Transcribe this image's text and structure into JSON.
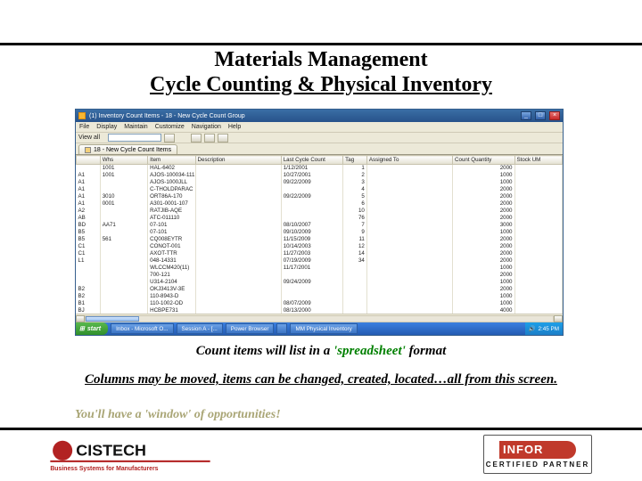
{
  "slide": {
    "title_line1": "Materials Management",
    "title_line2": "Cycle Counting & Physical Inventory",
    "caption1_prefix": "Count items will list in a ",
    "caption1_green": "'spreadsheet'",
    "caption1_suffix": " format",
    "caption2": "Columns may be moved, items can be changed, created, located…all from this screen.",
    "caption3": "You'll have a 'window' of opportunities!"
  },
  "logos": {
    "cistech_name": "CISTECH",
    "cistech_tag": "Business Systems for Manufacturers",
    "infor_name": "INFOR",
    "infor_tag": "CERTIFIED PARTNER"
  },
  "app": {
    "titlebar": "(1) Inventory Count Items - 18 - New Cycle Count Group",
    "menus": [
      "File",
      "Display",
      "Maintain",
      "Customize",
      "Navigation",
      "Help"
    ],
    "toolbar_label": "View all",
    "subtab": "18 - New Cycle Count Items",
    "columns": [
      "",
      "Whs",
      "Item",
      "Description",
      "Last Cycle Count",
      "Tag",
      "Assigned To",
      "Count Quantity",
      "Stock UM"
    ],
    "rows": [
      [
        "",
        "1001",
        "HAL-6402",
        "",
        "1/12/2001",
        "1",
        "",
        "2000",
        ""
      ],
      [
        "A1",
        "1001",
        "AJOS-100034-111",
        "",
        "10/27/2001",
        "2",
        "",
        "1000",
        ""
      ],
      [
        "A1",
        "",
        "AJOS-1000JLL",
        "",
        "09/22/2009",
        "3",
        "",
        "1000",
        ""
      ],
      [
        "A1",
        "",
        "C-THOLDPARAC",
        "",
        "",
        "4",
        "",
        "2000",
        ""
      ],
      [
        "A1",
        "3010",
        "ORT86A-170",
        "",
        "09/22/2009",
        "5",
        "",
        "2000",
        ""
      ],
      [
        "A1",
        "0001",
        "A301-0001-107",
        "",
        "",
        "6",
        "",
        "2000",
        ""
      ],
      [
        "A2",
        "",
        "RATJIB-AQE",
        "",
        "",
        "10",
        "",
        "2000",
        ""
      ],
      [
        "AB",
        "",
        "ATC-011110",
        "",
        "",
        "76",
        "",
        "2000",
        ""
      ],
      [
        "BD",
        "AA71",
        "07-101",
        "",
        "08/10/2007",
        "7",
        "",
        "3000",
        ""
      ],
      [
        "B5",
        "",
        "07-101",
        "",
        "09/10/2009",
        "9",
        "",
        "1000",
        ""
      ],
      [
        "B5",
        "561",
        "CQ008EYTR",
        "",
        "11/15/2009",
        "11",
        "",
        "2000",
        ""
      ],
      [
        "C1",
        "",
        "CONOT-001",
        "",
        "10/14/2003",
        "12",
        "",
        "2000",
        ""
      ],
      [
        "C1",
        "",
        "AXOT-TTR",
        "",
        "11/27/2003",
        "14",
        "",
        "2000",
        ""
      ],
      [
        "L1",
        "",
        "048-14331",
        "",
        "07/19/2009",
        "34",
        "",
        "2000",
        ""
      ],
      [
        "",
        "",
        "WLCCM420(11)",
        "",
        "11/17/2001",
        "",
        "",
        "1000",
        ""
      ],
      [
        "",
        "",
        "700-121",
        "",
        "",
        "",
        "",
        "2000",
        ""
      ],
      [
        "",
        "",
        "U314-2104",
        "",
        "09/24/2009",
        "",
        "",
        "1000",
        ""
      ],
      [
        "B2",
        "",
        "OKJ3413V-3E",
        "",
        "",
        "",
        "",
        "2000",
        ""
      ],
      [
        "B2",
        "",
        "110-8943-D",
        "",
        "",
        "",
        "",
        "1000",
        ""
      ],
      [
        "B1",
        "",
        "110-1002-OD",
        "",
        "08/07/2009",
        "",
        "",
        "1000",
        ""
      ],
      [
        "BJ",
        "",
        "HCBPE731",
        "",
        "08/13/2000",
        "",
        "",
        "4000",
        ""
      ]
    ],
    "start": "start",
    "taskbar": [
      "Inbox - Microsoft O...",
      "Session A - [...",
      "Power Browser",
      "",
      "MM Physical Inventory"
    ],
    "clock": "2:45 PM"
  }
}
